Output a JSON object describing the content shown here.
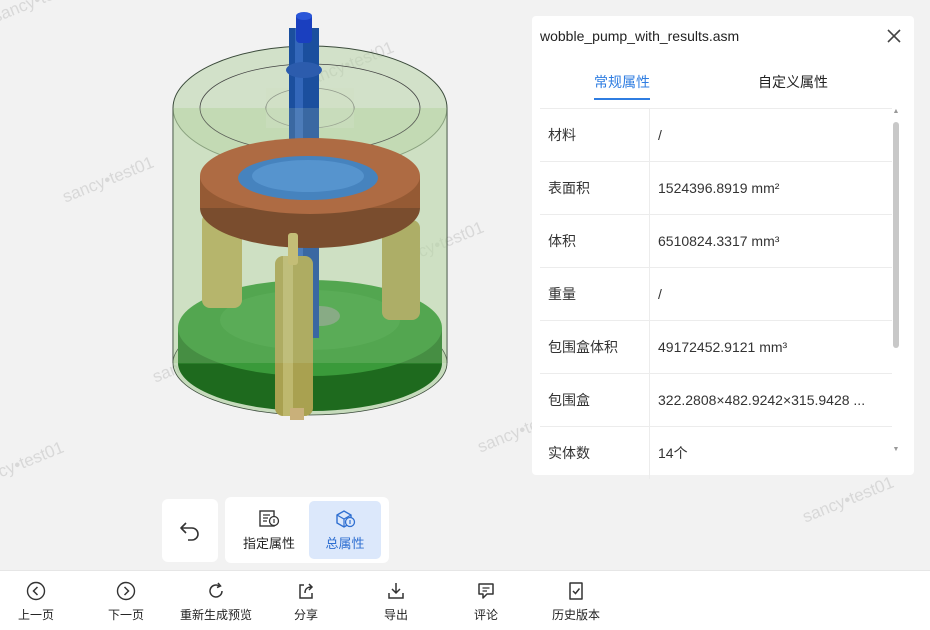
{
  "panel": {
    "title": "wobble_pump_with_results.asm",
    "tabs": [
      {
        "label": "常规属性",
        "active": true
      },
      {
        "label": "自定义属性",
        "active": false
      }
    ],
    "rows": [
      {
        "key": "材料",
        "value": "/"
      },
      {
        "key": "表面积",
        "value": "1524396.8919 mm²"
      },
      {
        "key": "体积",
        "value": "6510824.3317 mm³"
      },
      {
        "key": "重量",
        "value": "/"
      },
      {
        "key": "包围盒体积",
        "value": "49172452.9121 mm³"
      },
      {
        "key": "包围盒",
        "value": "322.2808×482.9242×315.9428 ..."
      },
      {
        "key": "实体数",
        "value": "14个"
      }
    ]
  },
  "toolbar": {
    "specified_props": "指定属性",
    "total_props": "总属性"
  },
  "bottombar": {
    "items": [
      "上一页",
      "下一页",
      "重新生成预览",
      "分享",
      "导出",
      "评论",
      "历史版本"
    ]
  },
  "watermark": "sancy•test01",
  "colors": {
    "accent": "#2f7de1",
    "active_bg": "#dce8fb"
  }
}
